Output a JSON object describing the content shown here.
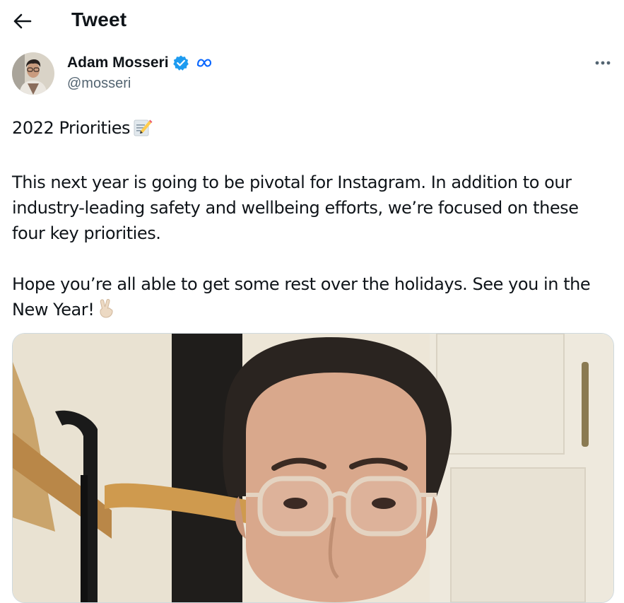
{
  "header": {
    "title": "Tweet"
  },
  "author": {
    "name": "Adam Mosseri",
    "handle": "@mosseri"
  },
  "tweet": {
    "line1": "2022 Priorities",
    "para2": "This next year is going to be pivotal for Instagram. In addition to our industry-leading safety and wellbeing efforts, we’re focused on these four key priorities.",
    "para3_start": "Hope you’re all able to get some rest over the holidays. See you in the New Year!"
  },
  "icons": {
    "back": "arrow-left-icon",
    "verified": "verified-badge-icon",
    "affiliate": "meta-logo-icon",
    "more": "more-horizontal-icon"
  },
  "colors": {
    "text": "#0f1419",
    "secondary": "#536471",
    "verified": "#1d9bf0",
    "affiliate": "#0866ff"
  }
}
